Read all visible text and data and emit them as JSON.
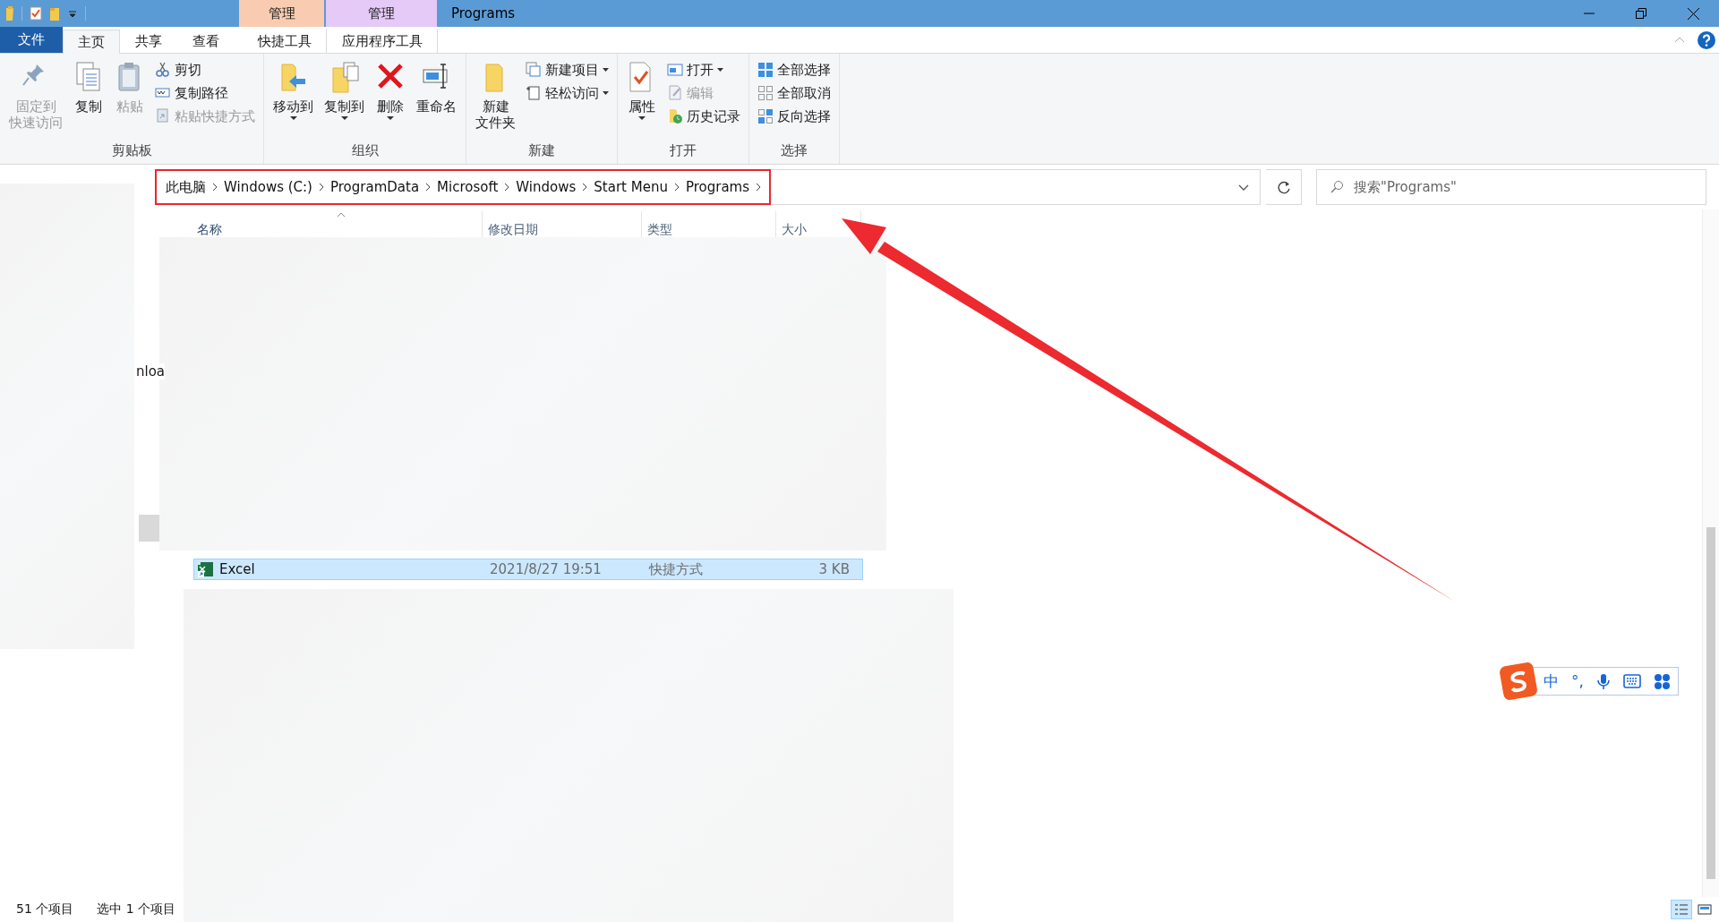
{
  "window": {
    "title": "Programs",
    "context_tabs": [
      {
        "label": "管理",
        "color": "#f9ccb1"
      },
      {
        "label": "管理",
        "color": "#e5c9f7"
      }
    ]
  },
  "file_menu": "文件",
  "ribbon_tabs": [
    {
      "label": "主页",
      "selected": true
    },
    {
      "label": "共享",
      "selected": false
    },
    {
      "label": "查看",
      "selected": false
    },
    {
      "label": "快捷工具",
      "selected": false
    },
    {
      "label": "应用程序工具",
      "selected": false
    }
  ],
  "ribbon_groups": [
    {
      "label": "剪贴板",
      "items": [
        {
          "kind": "large",
          "label_lines": [
            "固定到",
            "快速访问"
          ],
          "disabled": true,
          "dropdown": false
        },
        {
          "kind": "large",
          "label": "复制",
          "disabled": false,
          "dropdown": false
        },
        {
          "kind": "large",
          "label": "粘贴",
          "disabled": true,
          "dropdown": false
        },
        {
          "kind": "small",
          "label": "剪切",
          "disabled": false,
          "dropdown": false
        },
        {
          "kind": "small",
          "label": "复制路径",
          "disabled": false,
          "dropdown": false
        },
        {
          "kind": "small",
          "label": "粘贴快捷方式",
          "disabled": true,
          "dropdown": false
        }
      ]
    },
    {
      "label": "组织",
      "items": [
        {
          "kind": "large",
          "label": "移动到",
          "disabled": false,
          "dropdown": true
        },
        {
          "kind": "large",
          "label": "复制到",
          "disabled": false,
          "dropdown": true
        },
        {
          "kind": "large",
          "label": "删除",
          "disabled": false,
          "dropdown": true
        },
        {
          "kind": "large",
          "label": "重命名",
          "disabled": false,
          "dropdown": false
        }
      ]
    },
    {
      "label": "新建",
      "items": [
        {
          "kind": "large",
          "label_lines": [
            "新建",
            "文件夹"
          ],
          "disabled": false,
          "dropdown": false
        },
        {
          "kind": "small",
          "label": "新建项目",
          "disabled": false,
          "dropdown": true
        },
        {
          "kind": "small",
          "label": "轻松访问",
          "disabled": false,
          "dropdown": true
        }
      ]
    },
    {
      "label": "打开",
      "items": [
        {
          "kind": "large",
          "label": "属性",
          "disabled": false,
          "dropdown": true
        },
        {
          "kind": "small",
          "label": "打开",
          "disabled": false,
          "dropdown": true
        },
        {
          "kind": "small",
          "label": "编辑",
          "disabled": true,
          "dropdown": false
        },
        {
          "kind": "small",
          "label": "历史记录",
          "disabled": false,
          "dropdown": false
        }
      ]
    },
    {
      "label": "选择",
      "items": [
        {
          "kind": "small",
          "label": "全部选择",
          "disabled": false,
          "dropdown": false
        },
        {
          "kind": "small",
          "label": "全部取消",
          "disabled": false,
          "dropdown": false
        },
        {
          "kind": "small",
          "label": "反向选择",
          "disabled": false,
          "dropdown": false
        }
      ]
    }
  ],
  "address": {
    "breadcrumbs": [
      "此电脑",
      "Windows (C:)",
      "ProgramData",
      "Microsoft",
      "Windows",
      "Start Menu",
      "Programs"
    ]
  },
  "search": {
    "placeholder": "搜索\"Programs\""
  },
  "nav_items": [
    {
      "label": "nloa"
    }
  ],
  "columns": [
    {
      "label": "名称",
      "sorted": true
    },
    {
      "label": "修改日期",
      "sorted": false
    },
    {
      "label": "类型",
      "sorted": false
    },
    {
      "label": "大小",
      "sorted": false
    }
  ],
  "rows": [
    {
      "name": "Excel",
      "modified": "2021/8/27 19:51",
      "type": "快捷方式",
      "size": "3 KB",
      "selected": true
    }
  ],
  "status_bar": {
    "item_count": "51 个项目",
    "selection": "选中 1 个项目"
  },
  "view_buttons": [
    {
      "kind": "details",
      "selected": true
    },
    {
      "kind": "large-icons",
      "selected": false
    }
  ],
  "ime_toolbar": {
    "mode": "中",
    "punctuation": "°,"
  }
}
